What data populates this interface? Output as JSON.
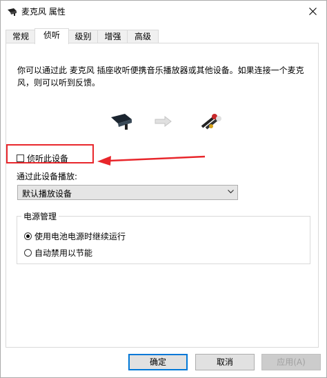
{
  "window": {
    "title": "麦克风 属性",
    "close_icon": "close-icon"
  },
  "tabs": [
    {
      "label": "常规",
      "active": false
    },
    {
      "label": "侦听",
      "active": true
    },
    {
      "label": "级别",
      "active": false
    },
    {
      "label": "增强",
      "active": false
    },
    {
      "label": "高级",
      "active": false
    }
  ],
  "listen": {
    "description": "你可以通过此 麦克风 插座收听便携音乐播放器或其他设备。如果连接一个麦克风，则可以听到反馈。",
    "checkbox_label": "侦听此设备",
    "checkbox_checked": false,
    "playback_label": "通过此设备播放:",
    "playback_selected": "默认播放设备"
  },
  "power": {
    "title": "电源管理",
    "options": [
      {
        "label": "使用电池电源时继续运行",
        "selected": true
      },
      {
        "label": "自动禁用以节能",
        "selected": false
      }
    ]
  },
  "buttons": {
    "ok": "确定",
    "cancel": "取消",
    "apply": "应用(A)"
  },
  "colors": {
    "highlight": "#e8262b",
    "accent": "#0078d7"
  }
}
